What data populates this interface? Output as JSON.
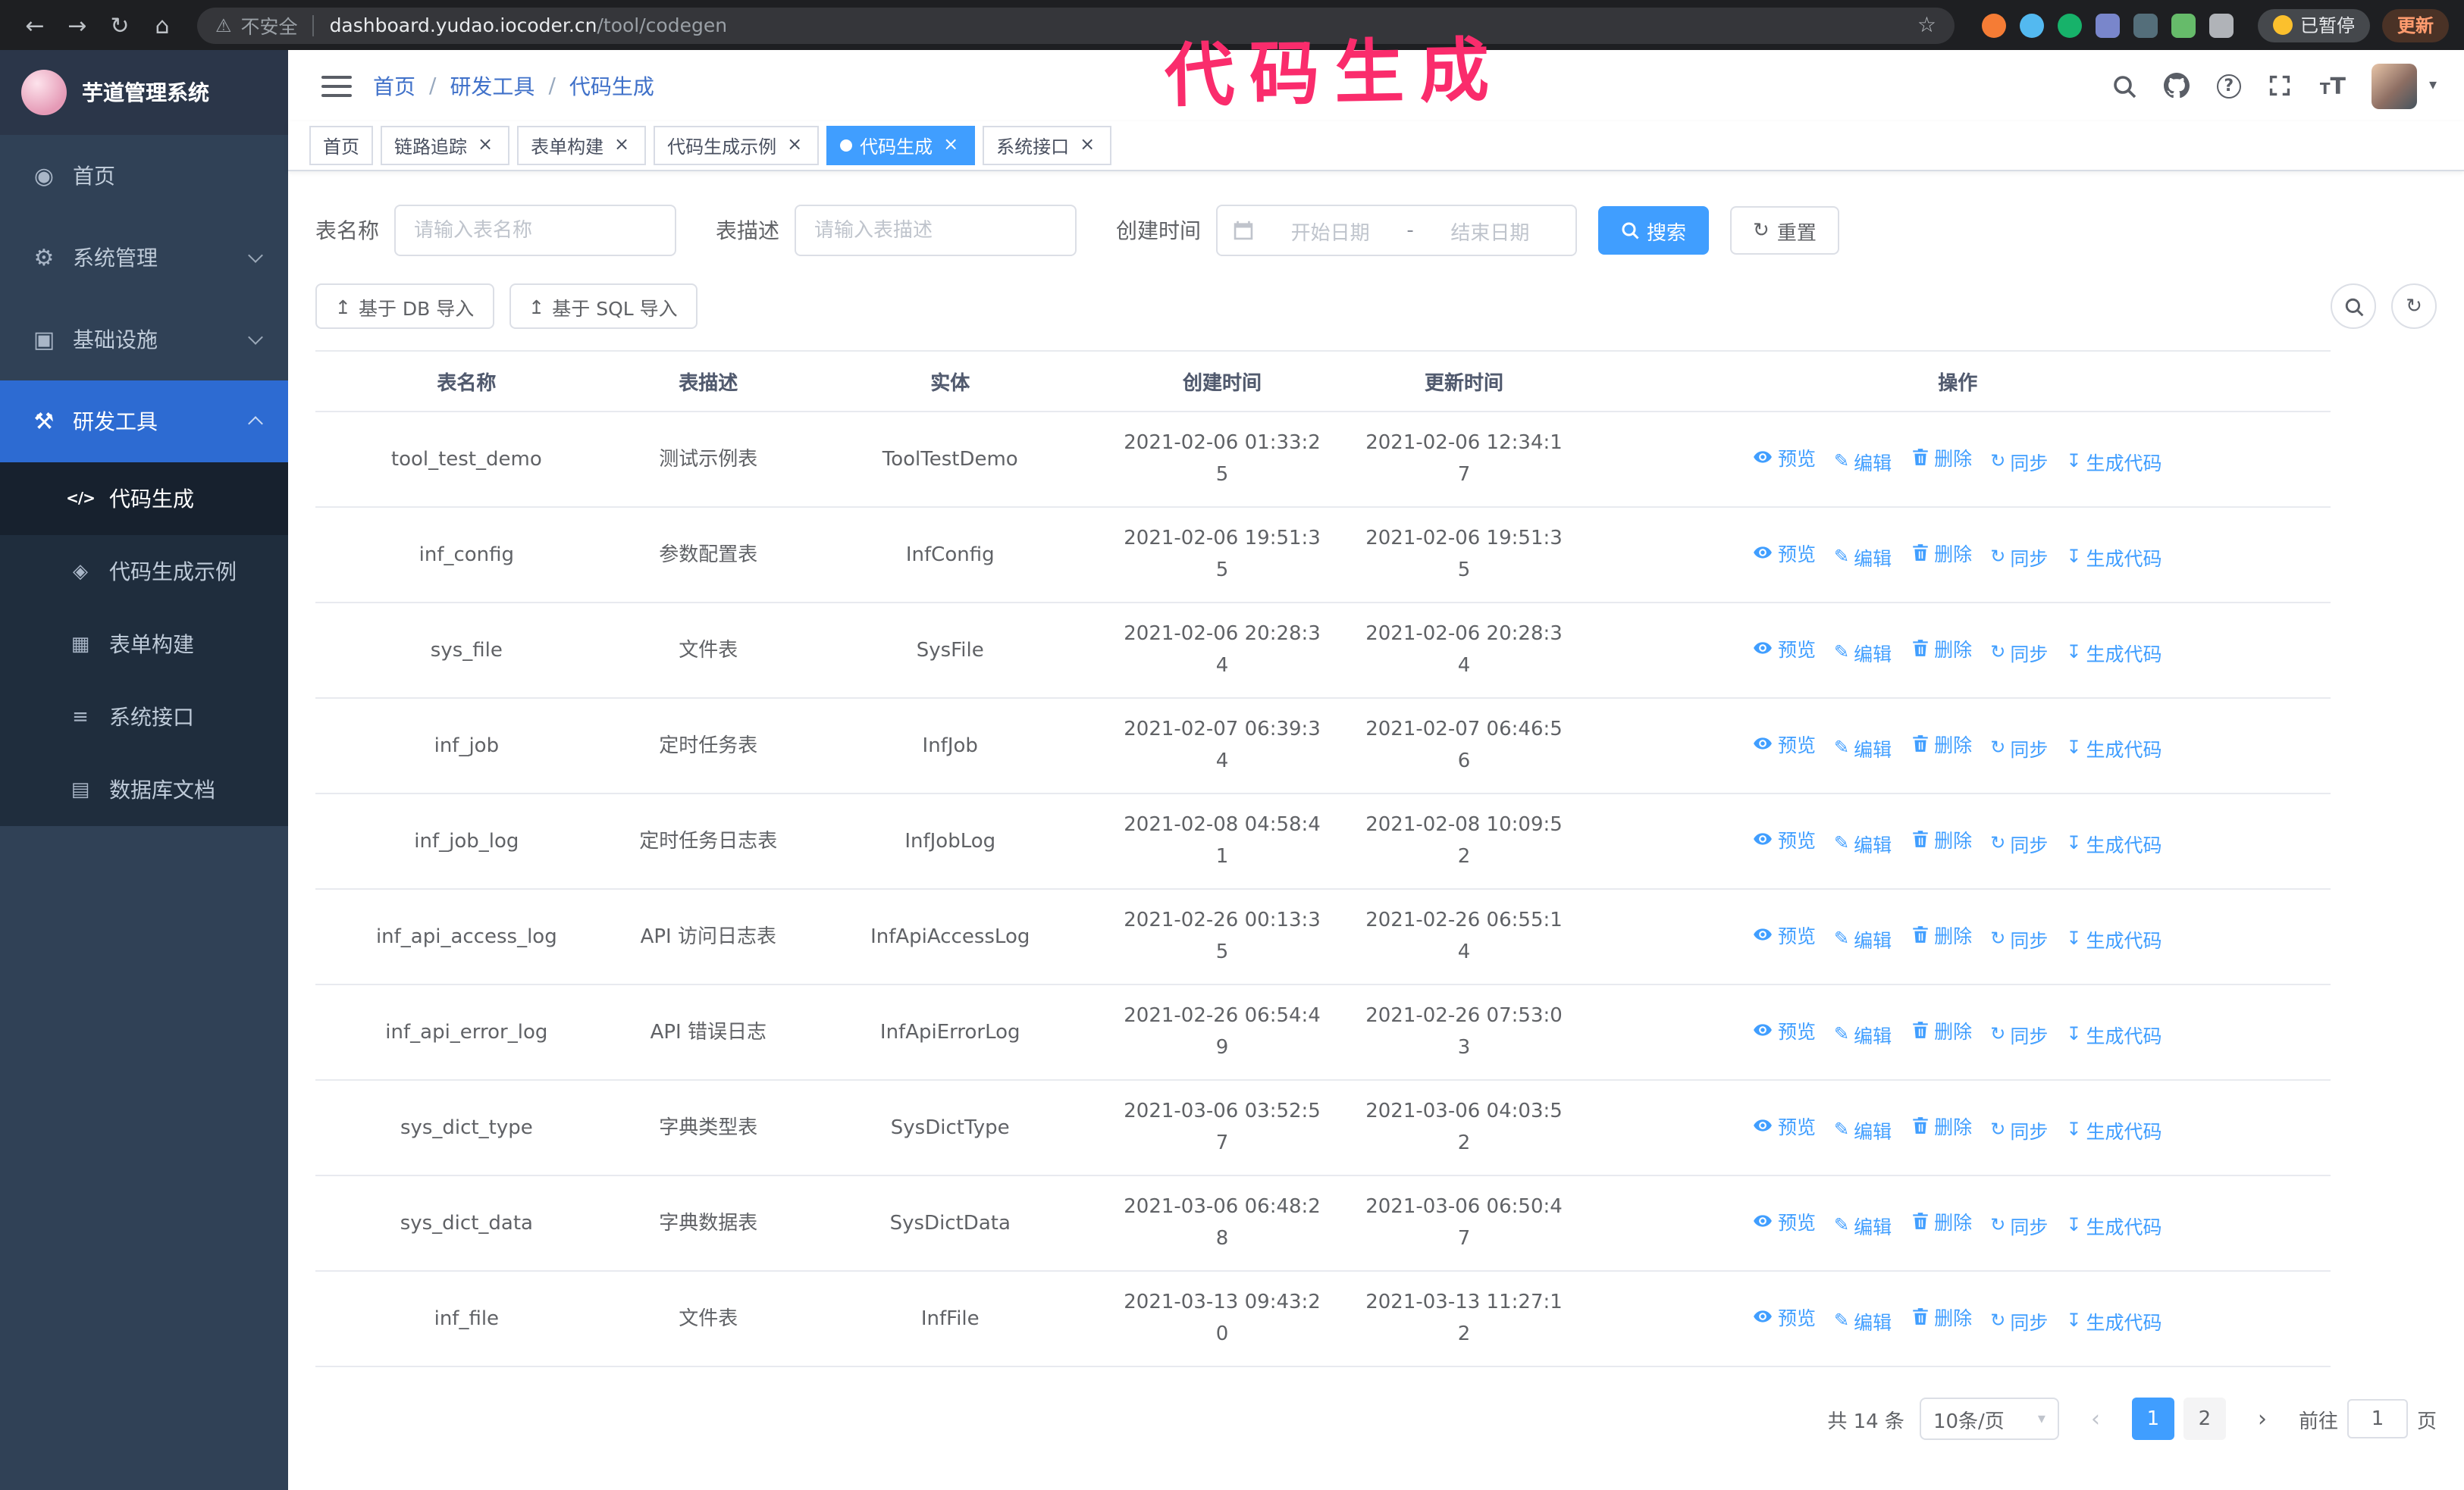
{
  "annotation": {
    "text": "代码生成",
    "color": "#fa2c6c"
  },
  "browser": {
    "insecure_label": "不安全",
    "url_host": "dashboard.yudao.iocoder.cn",
    "url_path": "/tool/codegen",
    "paused_badge": "已暂停",
    "update_button": "更新"
  },
  "sidebar": {
    "logo_title": "芋道管理系统",
    "items": [
      {
        "key": "home",
        "label": "首页",
        "icon": "home-icon"
      },
      {
        "key": "system",
        "label": "系统管理",
        "icon": "gear-icon",
        "chevron": "down"
      },
      {
        "key": "infra",
        "label": "基础设施",
        "icon": "infra-icon",
        "chevron": "down"
      },
      {
        "key": "devtools",
        "label": "研发工具",
        "icon": "tools-icon",
        "chevron": "up",
        "active": true,
        "children": [
          {
            "key": "codegen",
            "label": "代码生成",
            "icon": "code-icon",
            "active": true
          },
          {
            "key": "codegen-example",
            "label": "代码生成示例",
            "icon": "badge-icon"
          },
          {
            "key": "form-builder",
            "label": "表单构建",
            "icon": "form-icon"
          },
          {
            "key": "system-api",
            "label": "系统接口",
            "icon": "api-icon"
          },
          {
            "key": "db-doc",
            "label": "数据库文档",
            "icon": "database-icon"
          }
        ]
      }
    ]
  },
  "header": {
    "breadcrumb": [
      "首页",
      "研发工具",
      "代码生成"
    ]
  },
  "tabs": [
    {
      "key": "home",
      "label": "首页",
      "closable": false,
      "active": false
    },
    {
      "key": "tracing",
      "label": "链路追踪",
      "closable": true,
      "active": false
    },
    {
      "key": "form-builder",
      "label": "表单构建",
      "closable": true,
      "active": false
    },
    {
      "key": "codegen-example",
      "label": "代码生成示例",
      "closable": true,
      "active": false
    },
    {
      "key": "codegen",
      "label": "代码生成",
      "closable": true,
      "active": true
    },
    {
      "key": "system-api",
      "label": "系统接口",
      "closable": true,
      "active": false
    }
  ],
  "filters": {
    "table_name_label": "表名称",
    "table_name_placeholder": "请输入表名称",
    "table_desc_label": "表描述",
    "table_desc_placeholder": "请输入表描述",
    "create_time_label": "创建时间",
    "date_start_placeholder": "开始日期",
    "date_separator": "-",
    "date_end_placeholder": "结束日期",
    "search_button": "搜索",
    "reset_button": "重置"
  },
  "toolbar": {
    "import_db_button": "基于 DB 导入",
    "import_sql_button": "基于 SQL 导入"
  },
  "table": {
    "columns": [
      "表名称",
      "表描述",
      "实体",
      "创建时间",
      "更新时间",
      "操作"
    ],
    "actions": [
      "预览",
      "编辑",
      "删除",
      "同步",
      "生成代码"
    ],
    "rows": [
      {
        "name": "tool_test_demo",
        "desc": "测试示例表",
        "entity": "ToolTestDemo",
        "create_time": "2021-02-06 01:33:25",
        "update_time": "2021-02-06 12:34:17"
      },
      {
        "name": "inf_config",
        "desc": "参数配置表",
        "entity": "InfConfig",
        "create_time": "2021-02-06 19:51:35",
        "update_time": "2021-02-06 19:51:35"
      },
      {
        "name": "sys_file",
        "desc": "文件表",
        "entity": "SysFile",
        "create_time": "2021-02-06 20:28:34",
        "update_time": "2021-02-06 20:28:34"
      },
      {
        "name": "inf_job",
        "desc": "定时任务表",
        "entity": "InfJob",
        "create_time": "2021-02-07 06:39:34",
        "update_time": "2021-02-07 06:46:56"
      },
      {
        "name": "inf_job_log",
        "desc": "定时任务日志表",
        "entity": "InfJobLog",
        "create_time": "2021-02-08 04:58:41",
        "update_time": "2021-02-08 10:09:52"
      },
      {
        "name": "inf_api_access_log",
        "desc": "API 访问日志表",
        "entity": "InfApiAccessLog",
        "create_time": "2021-02-26 00:13:35",
        "update_time": "2021-02-26 06:55:14"
      },
      {
        "name": "inf_api_error_log",
        "desc": "API 错误日志",
        "entity": "InfApiErrorLog",
        "create_time": "2021-02-26 06:54:49",
        "update_time": "2021-02-26 07:53:03"
      },
      {
        "name": "sys_dict_type",
        "desc": "字典类型表",
        "entity": "SysDictType",
        "create_time": "2021-03-06 03:52:57",
        "update_time": "2021-03-06 04:03:52"
      },
      {
        "name": "sys_dict_data",
        "desc": "字典数据表",
        "entity": "SysDictData",
        "create_time": "2021-03-06 06:48:28",
        "update_time": "2021-03-06 06:50:47"
      },
      {
        "name": "inf_file",
        "desc": "文件表",
        "entity": "InfFile",
        "create_time": "2021-03-13 09:43:20",
        "update_time": "2021-03-13 11:27:12"
      }
    ]
  },
  "pagination": {
    "total_text": "共 14 条",
    "page_size": "10条/页",
    "pages": [
      "1",
      "2"
    ],
    "active_page": "1",
    "goto_label": "前往",
    "goto_value": "1",
    "goto_suffix": "页"
  },
  "colors": {
    "accent": "#409eff",
    "annotation_pink": "#fa2c6c",
    "sidebar_bg": "#304156",
    "submenu_bg": "#1f2d3d",
    "active_parent_bg": "#2d6bd2",
    "chrome_bg": "#1e1f22"
  }
}
